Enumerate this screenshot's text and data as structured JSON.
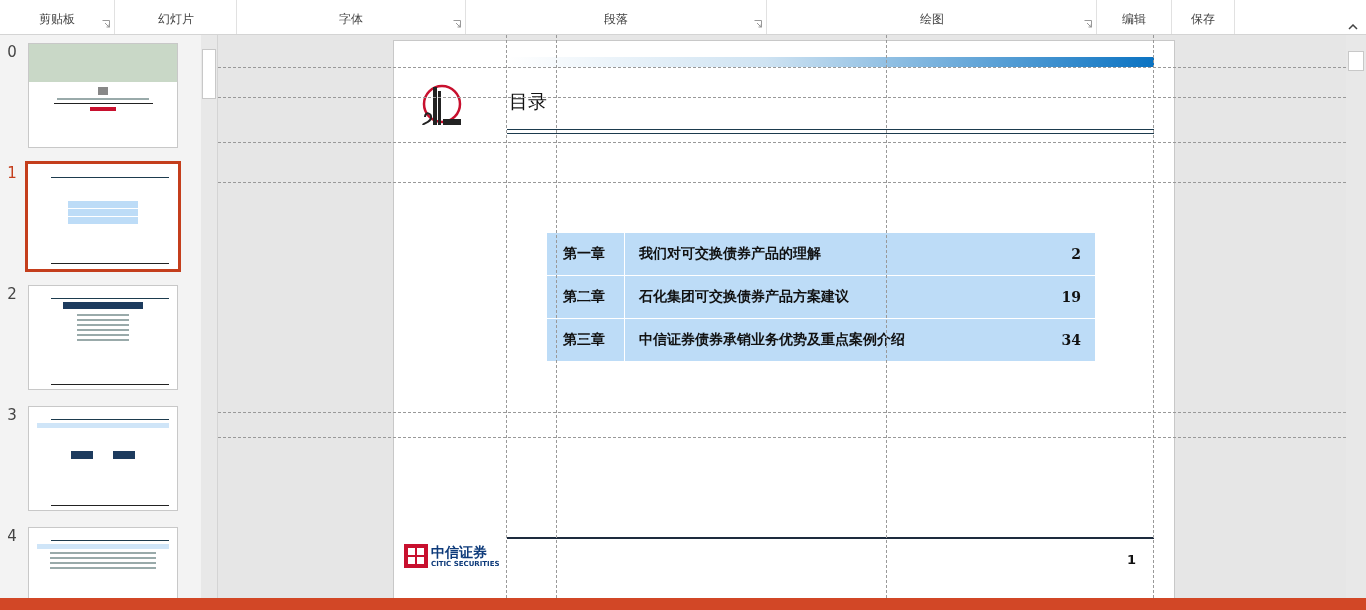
{
  "ribbon": {
    "groups": [
      {
        "label": "剪贴板",
        "launcher": true
      },
      {
        "label": "幻灯片",
        "launcher": false
      },
      {
        "label": "字体",
        "launcher": true
      },
      {
        "label": "段落",
        "launcher": true
      },
      {
        "label": "绘图",
        "launcher": true
      },
      {
        "label": "编辑",
        "launcher": false
      },
      {
        "label": "保存",
        "launcher": false
      }
    ]
  },
  "thumbnails": [
    {
      "number": "0",
      "selected": false,
      "kind": "cover"
    },
    {
      "number": "1",
      "selected": true,
      "kind": "toc"
    },
    {
      "number": "2",
      "selected": false,
      "kind": "list"
    },
    {
      "number": "3",
      "selected": false,
      "kind": "diagram"
    },
    {
      "number": "4",
      "selected": false,
      "kind": "text"
    }
  ],
  "slide": {
    "title": "目录",
    "toc": [
      {
        "chapter": "第一章",
        "title": "我们对可交换债券产品的理解",
        "page": "2"
      },
      {
        "chapter": "第二章",
        "title": "石化集团可交换债券产品方案建议",
        "page": "19"
      },
      {
        "chapter": "第三章",
        "title": "中信证券债券承销业务优势及重点案例介绍",
        "page": "34"
      }
    ],
    "footer_logo": {
      "name": "中信证券",
      "subtitle": "CITIC SECURITIES"
    },
    "page_number": "1"
  }
}
